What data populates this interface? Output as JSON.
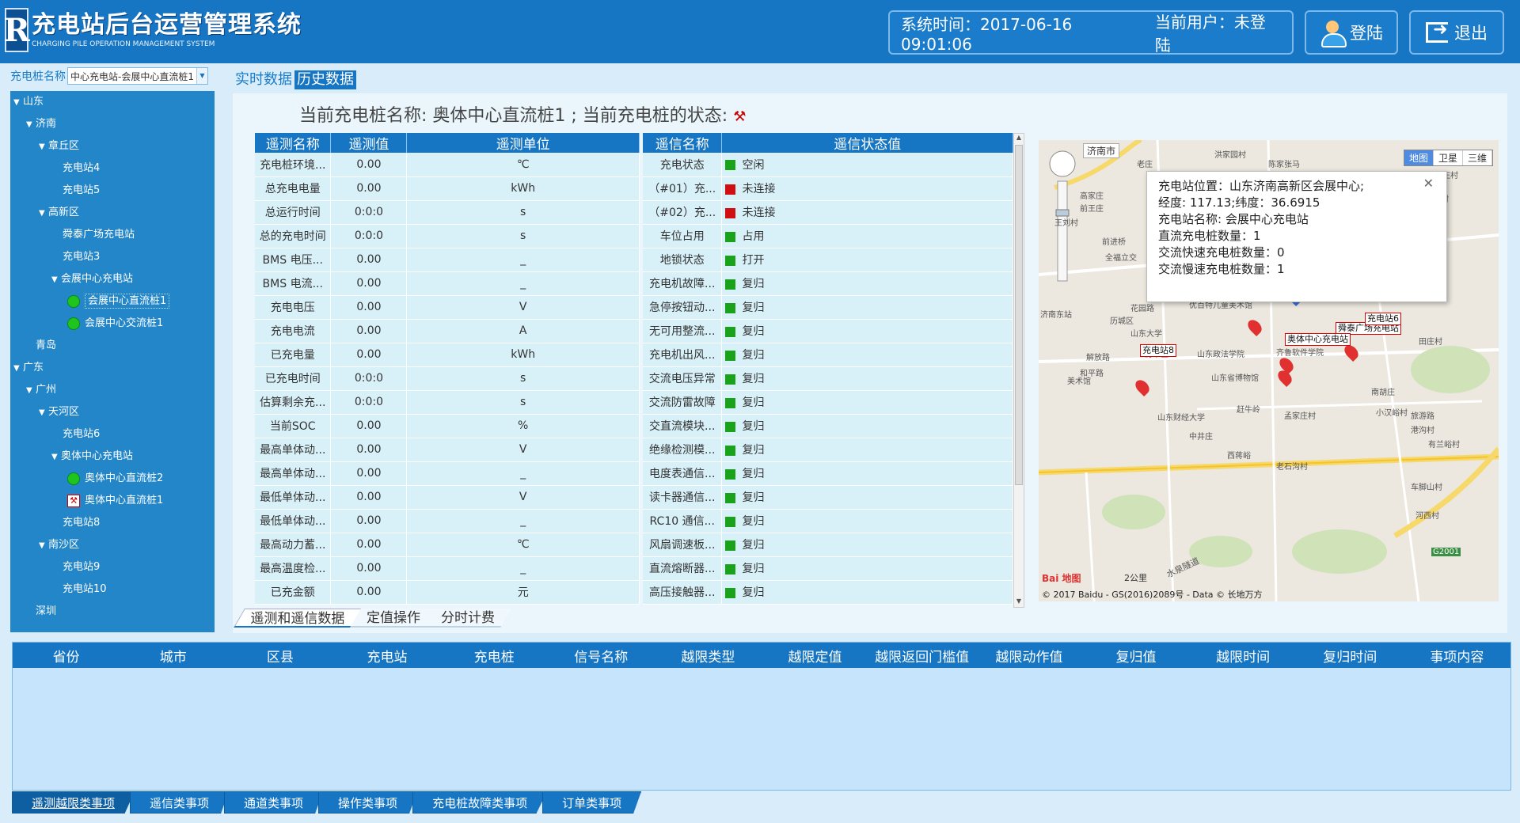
{
  "app": {
    "title_cn": "充电站后台运营管理系统",
    "title_en": "CHARGING PILE OPERATION MANAGEMENT SYSTEM",
    "logo_letter": "R"
  },
  "header": {
    "system_time": "系统时间：2017-06-16 09:01:06",
    "current_user": "当前用户：未登陆",
    "login_label": "登陆",
    "exit_label": "退出"
  },
  "selector": {
    "label": "充电桩名称",
    "value": "中心充电站-会展中心直流桩1"
  },
  "top_tabs": {
    "realtime": "实时数据",
    "history": "历史数据"
  },
  "tree": [
    {
      "label": "山东",
      "level": 0,
      "expand": true
    },
    {
      "label": "济南",
      "level": 1,
      "expand": true
    },
    {
      "label": "章丘区",
      "level": 2,
      "expand": true
    },
    {
      "label": "充电站4",
      "level": 3
    },
    {
      "label": "充电站5",
      "level": 3
    },
    {
      "label": "高新区",
      "level": 2,
      "expand": true
    },
    {
      "label": "舜泰广场充电站",
      "level": 3
    },
    {
      "label": "充电站3",
      "level": 3
    },
    {
      "label": "会展中心充电站",
      "level": 3,
      "expand": true
    },
    {
      "label": "会展中心直流桩1",
      "level": 4,
      "icon": "green",
      "selected": true
    },
    {
      "label": "会展中心交流桩1",
      "level": 4,
      "icon": "green"
    },
    {
      "label": "青岛",
      "level": 1
    },
    {
      "label": "广东",
      "level": 0,
      "expand": true
    },
    {
      "label": "广州",
      "level": 1,
      "expand": true
    },
    {
      "label": "天河区",
      "level": 2,
      "expand": true
    },
    {
      "label": "充电站6",
      "level": 3
    },
    {
      "label": "奥体中心充电站",
      "level": 3,
      "expand": true
    },
    {
      "label": "奥体中心直流桩2",
      "level": 4,
      "icon": "green"
    },
    {
      "label": "奥体中心直流桩1",
      "level": 4,
      "icon": "fault"
    },
    {
      "label": "充电站8",
      "level": 3
    },
    {
      "label": "南沙区",
      "level": 2,
      "expand": true
    },
    {
      "label": "充电站9",
      "level": 3
    },
    {
      "label": "充电站10",
      "level": 3
    },
    {
      "label": "深圳",
      "level": 1
    }
  ],
  "current": {
    "title": "当前充电桩名称: 奥体中心直流桩1 ; 当前充电桩的状态:",
    "status_icon": "fault-icon"
  },
  "telemetry": {
    "headers": [
      "遥测名称",
      "遥测值",
      "遥测单位"
    ],
    "rows": [
      [
        "充电桩环境...",
        "0.00",
        "℃"
      ],
      [
        "总充电电量",
        "0.00",
        "kWh"
      ],
      [
        "总运行时间",
        "0:0:0",
        "s"
      ],
      [
        "总的充电时间",
        "0:0:0",
        "s"
      ],
      [
        "BMS 电压...",
        "0.00",
        "_"
      ],
      [
        "BMS 电流...",
        "0.00",
        "_"
      ],
      [
        "充电电压",
        "0.00",
        "V"
      ],
      [
        "充电电流",
        "0.00",
        "A"
      ],
      [
        "已充电量",
        "0.00",
        "kWh"
      ],
      [
        "已充电时间",
        "0:0:0",
        "s"
      ],
      [
        "估算剩余充...",
        "0:0:0",
        "s"
      ],
      [
        "当前SOC",
        "0.00",
        "%"
      ],
      [
        "最高单体动...",
        "0.00",
        "V"
      ],
      [
        "最高单体动...",
        "0.00",
        "_"
      ],
      [
        "最低单体动...",
        "0.00",
        "V"
      ],
      [
        "最低单体动...",
        "0.00",
        "_"
      ],
      [
        "最高动力蓄...",
        "0.00",
        "℃"
      ],
      [
        "最高温度检...",
        "0.00",
        "_"
      ],
      [
        "已充金额",
        "0.00",
        "元"
      ]
    ]
  },
  "signals": {
    "headers": [
      "遥信名称",
      "遥信状态值"
    ],
    "rows": [
      [
        "充电状态",
        "空闲",
        "#1aa31a"
      ],
      [
        "（#01）充...",
        "未连接",
        "#d01010"
      ],
      [
        "（#02）充...",
        "未连接",
        "#d01010"
      ],
      [
        "车位占用",
        "占用",
        "#1aa31a"
      ],
      [
        "地锁状态",
        "打开",
        "#1aa31a"
      ],
      [
        "充电机故障...",
        "复归",
        "#1aa31a"
      ],
      [
        "急停按钮动...",
        "复归",
        "#1aa31a"
      ],
      [
        "无可用整流...",
        "复归",
        "#1aa31a"
      ],
      [
        "充电机出风...",
        "复归",
        "#1aa31a"
      ],
      [
        "交流电压异常",
        "复归",
        "#1aa31a"
      ],
      [
        "交流防雷故障",
        "复归",
        "#1aa31a"
      ],
      [
        "交直流模块...",
        "复归",
        "#1aa31a"
      ],
      [
        "绝缘检测模...",
        "复归",
        "#1aa31a"
      ],
      [
        "电度表通信...",
        "复归",
        "#1aa31a"
      ],
      [
        "读卡器通信...",
        "复归",
        "#1aa31a"
      ],
      [
        "RC10 通信...",
        "复归",
        "#1aa31a"
      ],
      [
        "风扇调速板...",
        "复归",
        "#1aa31a"
      ],
      [
        "直流熔断器...",
        "复归",
        "#1aa31a"
      ],
      [
        "高压接触器...",
        "复归",
        "#1aa31a"
      ]
    ]
  },
  "sub_tabs": [
    "遥测和遥信数据",
    "定值操作",
    "分时计费"
  ],
  "map": {
    "city": "济南市",
    "types": [
      "地图",
      "卫星",
      "三维"
    ],
    "popup": [
      "充电站位置：山东济南高新区会展中心;",
      "经度: 117.13;纬度：36.6915",
      "充电站名称: 会展中心充电站",
      "直流充电桩数量：1",
      "交流快速充电桩数量：0",
      "交流慢速充电桩数量：1"
    ],
    "markers": [
      {
        "label": "会展中心充电站",
        "color": "#3b6fd6"
      },
      {
        "label": "充电站10",
        "color": "#e03030"
      },
      {
        "label": "舜泰广场充电站",
        "color": "#e03030"
      },
      {
        "label": "充电站6",
        "color": "#e03030"
      },
      {
        "label": "奥体中心充电站",
        "color": "#e03030"
      },
      {
        "label": "充电站8",
        "color": "#e03030"
      }
    ],
    "places": [
      "老庄",
      "洪家园村",
      "陈家张马",
      "侯家庄村",
      "韩仓村",
      "高家庄",
      "前王庄",
      "王刘村",
      "前进桥",
      "全福立交",
      "花园东路",
      "花园路",
      "历城区",
      "山东大学",
      "解放路",
      "和平路",
      "美术馆",
      "历下区",
      "山东政法学院",
      "山东省博物馆",
      "齐鲁软件学院",
      "安家村",
      "田庄村",
      "南胡庄",
      "小汉峪村",
      "旅游路",
      "港沟村",
      "老石沟村",
      "车脚山村",
      "河西村",
      "有兰峪村",
      "山东财经大学",
      "孟家庄村",
      "中井庄",
      "西蒋峪",
      "赶牛岭",
      "济南东站",
      "优百特儿童美术馆"
    ],
    "roads": [
      "G2001",
      "2公里",
      "水泉隧道"
    ],
    "copyright": "© 2017 Baidu - GS(2016)2089号 - Data © 长地万方",
    "baidu": "Bai 地图"
  },
  "events": {
    "headers": [
      "省份",
      "城市",
      "区县",
      "充电站",
      "充电桩",
      "信号名称",
      "越限类型",
      "越限定值",
      "越限返回门槛值",
      "越限动作值",
      "复归值",
      "越限时间",
      "复归时间",
      "事项内容"
    ]
  },
  "bottom_tabs": [
    "遥测越限类事项",
    "遥信类事项",
    "通道类事项",
    "操作类事项",
    "充电桩故障类事项",
    "订单类事项"
  ]
}
